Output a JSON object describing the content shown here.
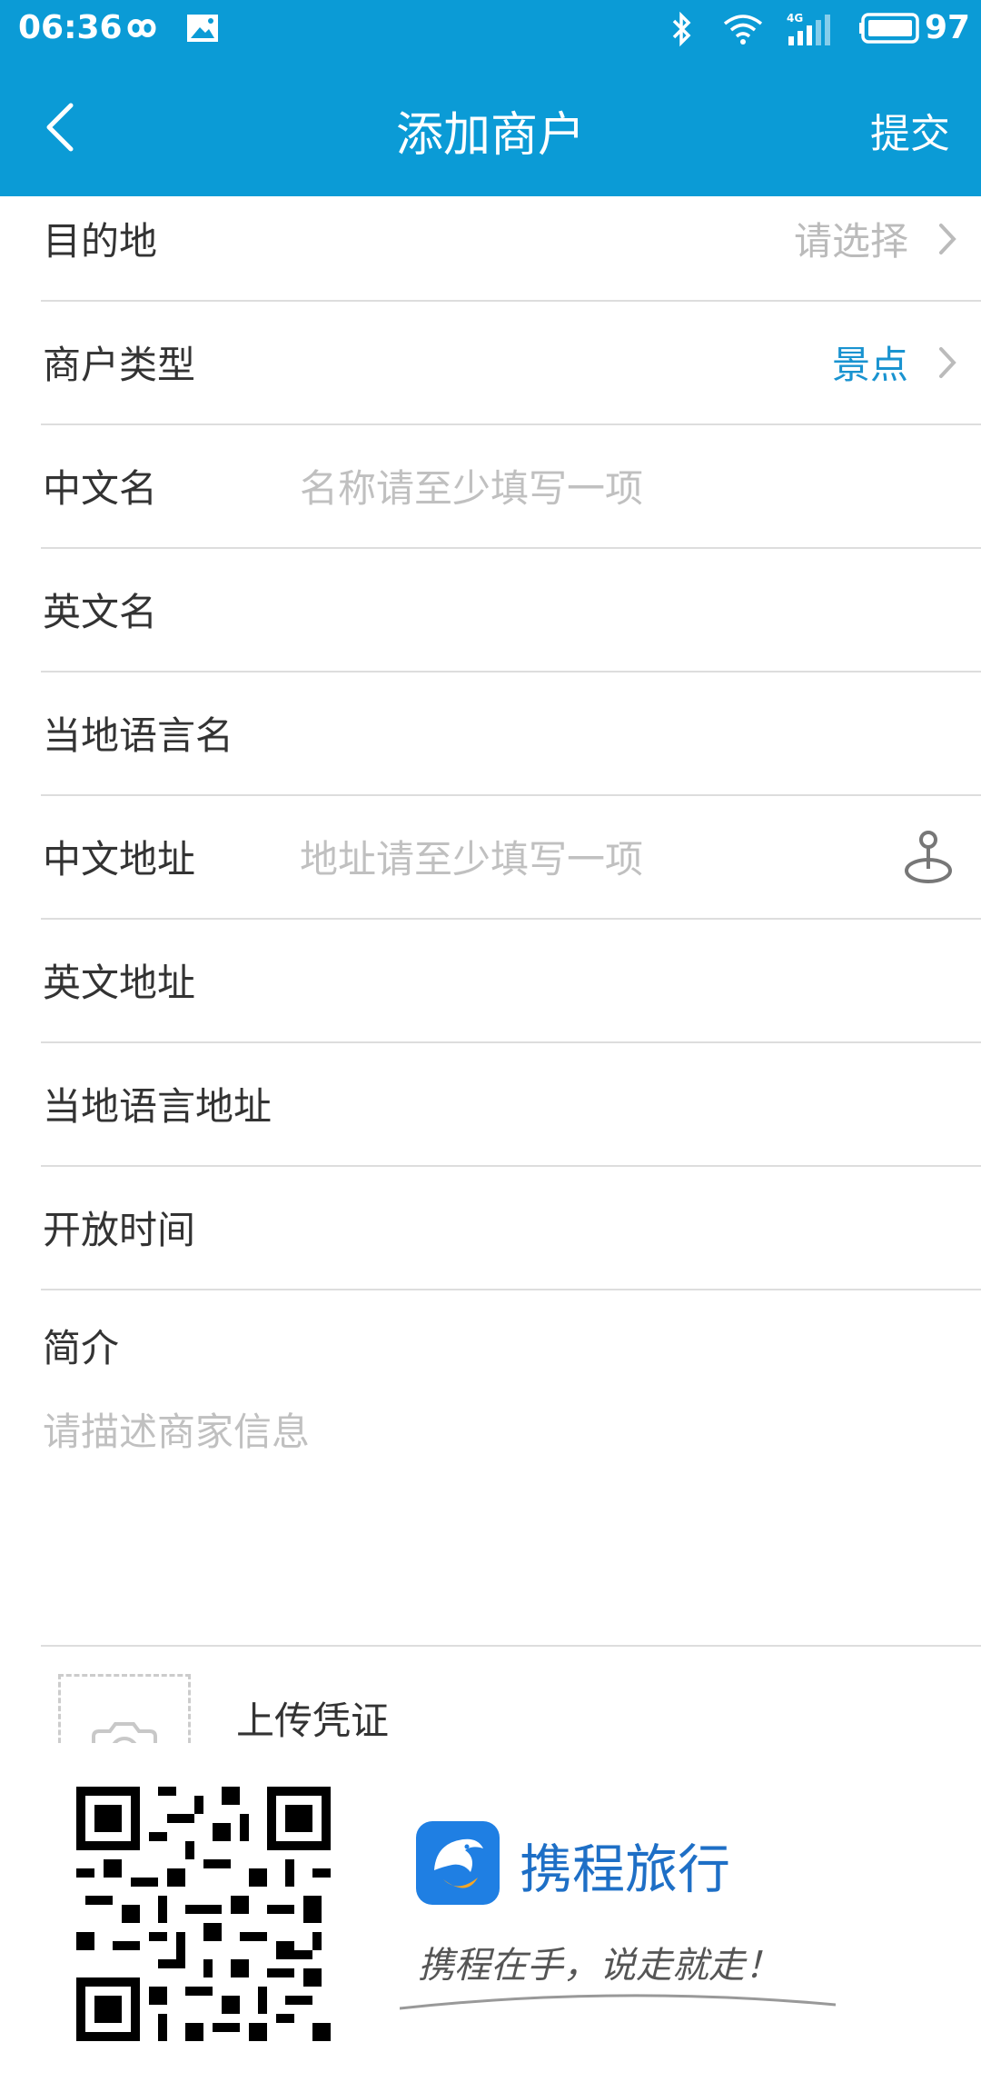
{
  "status_bar": {
    "time": "06:36",
    "battery": "97",
    "icons": [
      "infinity-icon",
      "image-icon",
      "bluetooth-icon",
      "wifi-icon",
      "signal-4g-icon",
      "battery-icon"
    ]
  },
  "header": {
    "title": "添加商户",
    "submit_label": "提交",
    "back_icon": "back-arrow-icon"
  },
  "form": {
    "destination": {
      "label": "目的地",
      "value": "请选择"
    },
    "merchant_type": {
      "label": "商户类型",
      "value": "景点"
    },
    "chinese_name": {
      "label": "中文名",
      "placeholder": "名称请至少填写一项"
    },
    "english_name": {
      "label": "英文名"
    },
    "local_name": {
      "label": "当地语言名"
    },
    "chinese_address": {
      "label": "中文地址",
      "placeholder": "地址请至少填写一项"
    },
    "english_address": {
      "label": "英文地址"
    },
    "local_address": {
      "label": "当地语言地址"
    },
    "opening_hours": {
      "label": "开放时间"
    },
    "intro": {
      "label": "简介",
      "placeholder": "请描述商家信息"
    },
    "upload": {
      "label": "上传凭证"
    }
  },
  "promo": {
    "app_name": "携程旅行",
    "slogan": "携程在手，说走就走！"
  },
  "colors": {
    "brand": "#0B9BD6",
    "accent_text": "#1993D0",
    "placeholder": "#BBBBBB",
    "divider": "#DDDDDD"
  }
}
